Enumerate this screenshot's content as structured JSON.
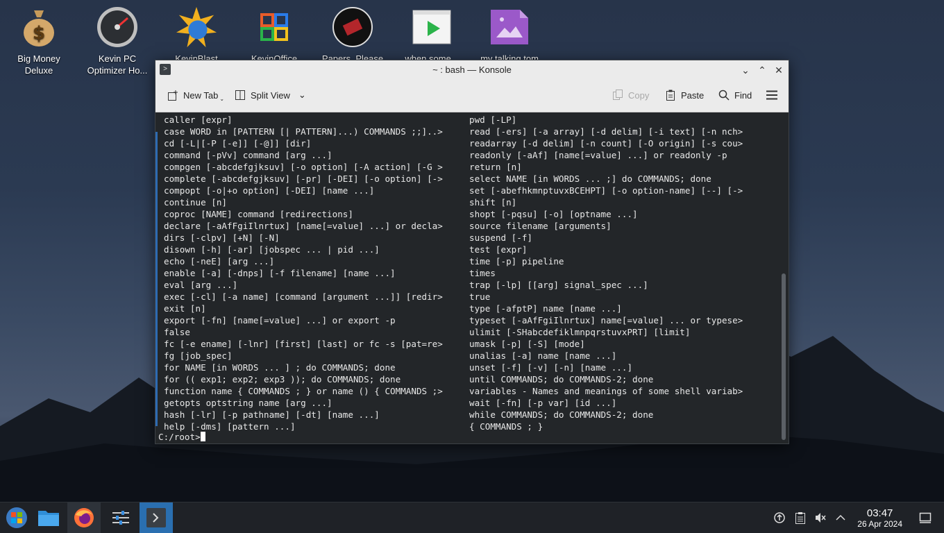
{
  "desktop": {
    "icons": [
      {
        "label": "Big Money\nDeluxe",
        "line1": "Big Money",
        "line2": "Deluxe"
      },
      {
        "label": "Kevin PC Optimizer Ho...",
        "line1": "Kevin PC",
        "line2": "Optimizer Ho..."
      },
      {
        "label": "KevinBlast",
        "line1": "KevinBlast",
        "line2": ""
      },
      {
        "label": "KevinOffice",
        "line1": "KevinOffice",
        "line2": ""
      },
      {
        "label": "Papers, Please",
        "line1": "Papers, Please",
        "line2": ""
      },
      {
        "label": "when some...",
        "line1": "when some...",
        "line2": ""
      },
      {
        "label": "my talking tom",
        "line1": "my talking tom",
        "line2": ""
      }
    ]
  },
  "window": {
    "title": "~ : bash — Konsole",
    "toolbar": {
      "new_tab": "New Tab",
      "split_view": "Split View",
      "copy": "Copy",
      "paste": "Paste",
      "find": "Find"
    }
  },
  "terminal": {
    "left": [
      "caller [expr]",
      "case WORD in [PATTERN [| PATTERN]...) COMMANDS ;;]..>",
      "cd [-L|[-P [-e]] [-@]] [dir]",
      "command [-pVv] command [arg ...]",
      "compgen [-abcdefgjksuv] [-o option] [-A action] [-G >",
      "complete [-abcdefgjksuv] [-pr] [-DEI] [-o option] [->",
      "compopt [-o|+o option] [-DEI] [name ...]",
      "continue [n]",
      "coproc [NAME] command [redirections]",
      "declare [-aAfFgiIlnrtux] [name[=value] ...] or decla>",
      "dirs [-clpv] [+N] [-N]",
      "disown [-h] [-ar] [jobspec ... | pid ...]",
      "echo [-neE] [arg ...]",
      "enable [-a] [-dnps] [-f filename] [name ...]",
      "eval [arg ...]",
      "exec [-cl] [-a name] [command [argument ...]] [redir>",
      "exit [n]",
      "export [-fn] [name[=value] ...] or export -p",
      "false",
      "fc [-e ename] [-lnr] [first] [last] or fc -s [pat=re>",
      "fg [job_spec]",
      "for NAME [in WORDS ... ] ; do COMMANDS; done",
      "for (( exp1; exp2; exp3 )); do COMMANDS; done",
      "function name { COMMANDS ; } or name () { COMMANDS ;>",
      "getopts optstring name [arg ...]",
      "hash [-lr] [-p pathname] [-dt] [name ...]",
      "help [-dms] [pattern ...]"
    ],
    "right": [
      "pwd [-LP]",
      "read [-ers] [-a array] [-d delim] [-i text] [-n nch>",
      "readarray [-d delim] [-n count] [-O origin] [-s cou>",
      "readonly [-aAf] [name[=value] ...] or readonly -p",
      "return [n]",
      "select NAME [in WORDS ... ;] do COMMANDS; done",
      "set [-abefhkmnptuvxBCEHPT] [-o option-name] [--] [->",
      "shift [n]",
      "shopt [-pqsu] [-o] [optname ...]",
      "source filename [arguments]",
      "suspend [-f]",
      "test [expr]",
      "time [-p] pipeline",
      "times",
      "trap [-lp] [[arg] signal_spec ...]",
      "true",
      "type [-afptP] name [name ...]",
      "typeset [-aAfFgiIlnrtux] name[=value] ... or typese>",
      "ulimit [-SHabcdefiklmnpqrstuvxPRT] [limit]",
      "umask [-p] [-S] [mode]",
      "unalias [-a] name [name ...]",
      "unset [-f] [-v] [-n] [name ...]",
      "until COMMANDS; do COMMANDS-2; done",
      "variables - Names and meanings of some shell variab>",
      "wait [-fn] [-p var] [id ...]",
      "while COMMANDS; do COMMANDS-2; done",
      "{ COMMANDS ; }"
    ],
    "prompt": "C:/root>"
  },
  "taskbar": {
    "time": "03:47",
    "date": "26 Apr 2024"
  }
}
